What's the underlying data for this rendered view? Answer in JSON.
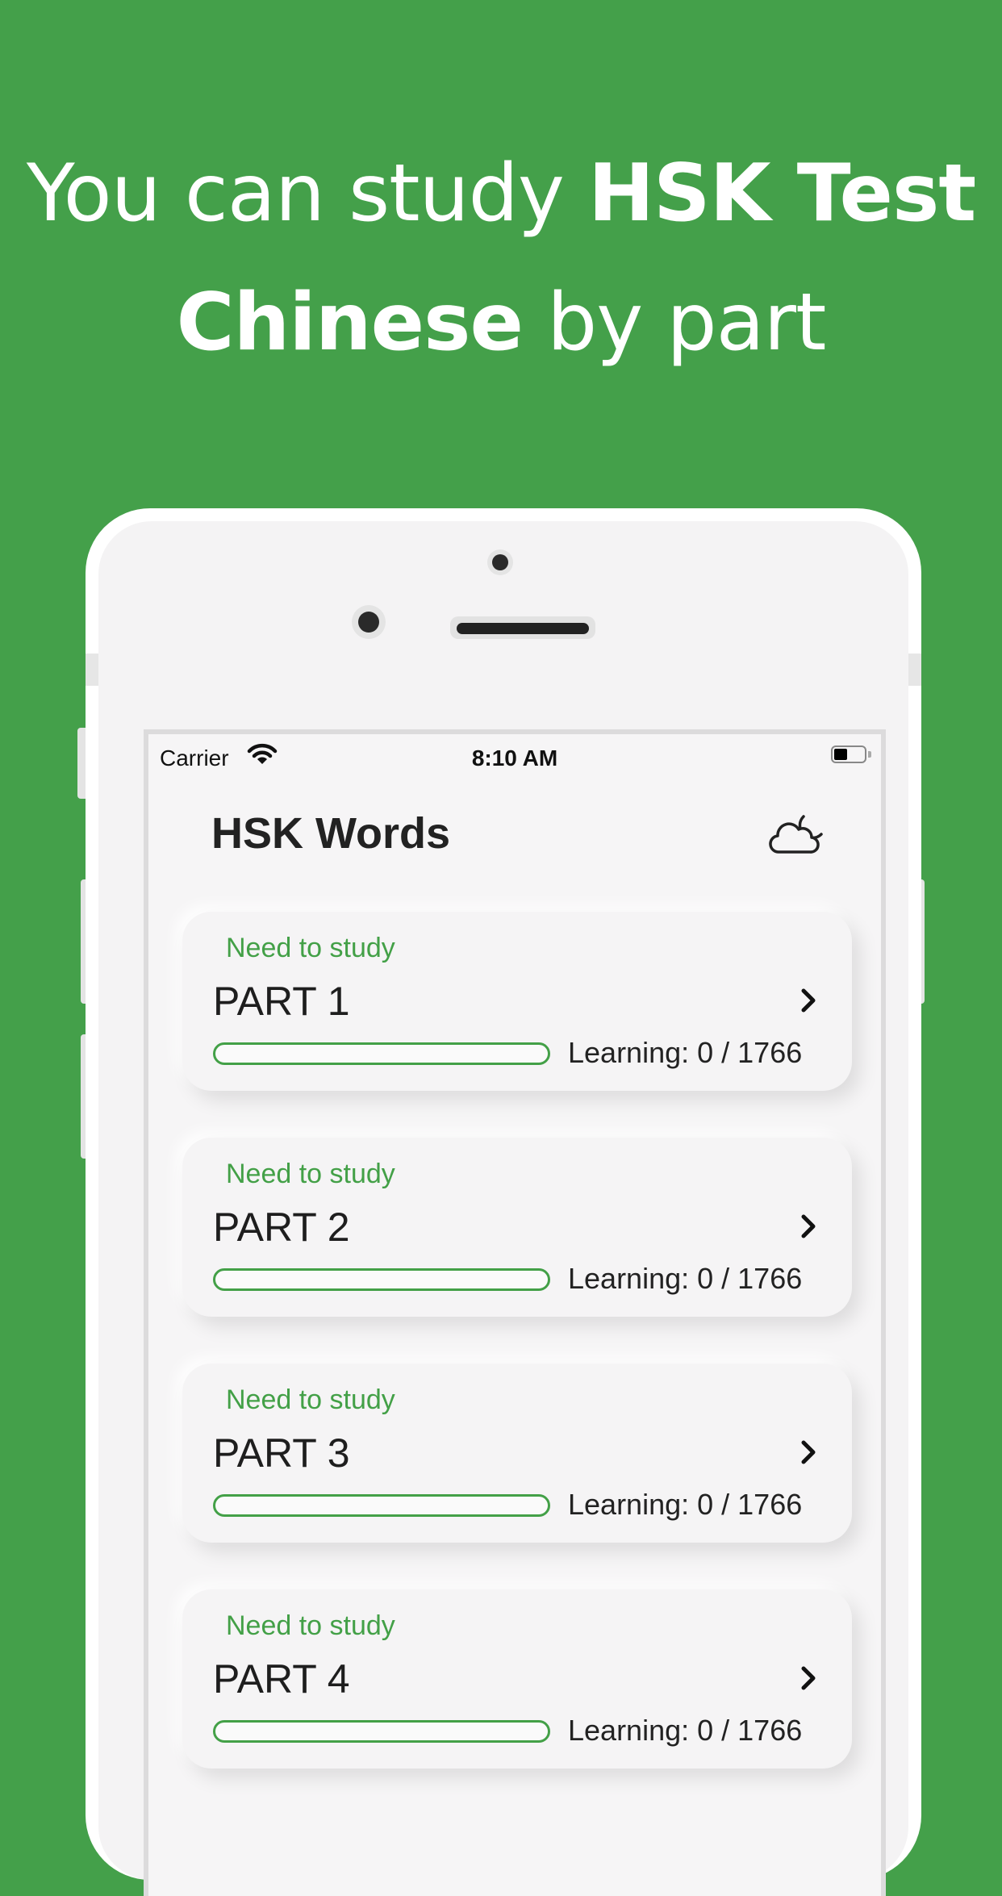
{
  "promo": {
    "line1_light": "You can study ",
    "line1_bold": "HSK Test",
    "line2_bold": "Chinese",
    "line2_light": " by part"
  },
  "status_bar": {
    "carrier": "Carrier",
    "time": "8:10 AM",
    "battery_level": 0.45
  },
  "header": {
    "title": "HSK Words",
    "theme_icon": "cloud-moon-icon"
  },
  "parts": [
    {
      "status": "Need to study",
      "title": "PART 1",
      "learning": "Learning: 0 / 1766",
      "progress": 0
    },
    {
      "status": "Need to study",
      "title": "PART 2",
      "learning": "Learning: 0 / 1766",
      "progress": 0
    },
    {
      "status": "Need to study",
      "title": "PART 3",
      "learning": "Learning: 0 / 1766",
      "progress": 0
    },
    {
      "status": "Need to study",
      "title": "PART 4",
      "learning": "Learning: 0 / 1766",
      "progress": 0
    }
  ],
  "colors": {
    "background": "#44a04a",
    "accent": "#43a047"
  }
}
